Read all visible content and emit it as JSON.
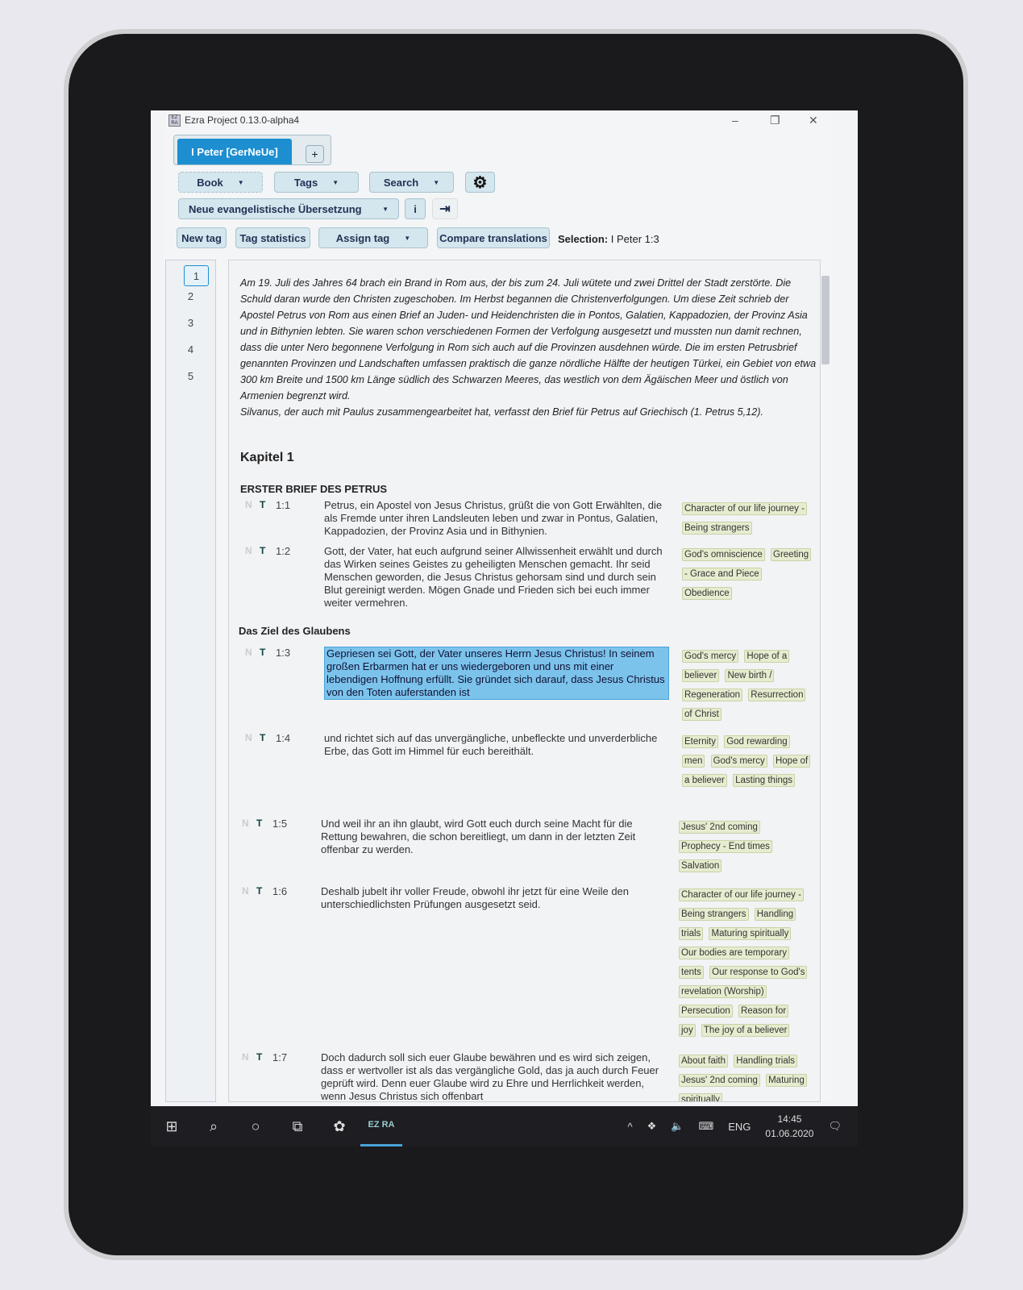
{
  "window": {
    "title": "Ezra Project 0.13.0-alpha4",
    "app_icon": "EZ RA",
    "min": "–",
    "max": "❐",
    "close": "✕"
  },
  "tabs": {
    "active": "I Peter [GerNeUe]",
    "add": "+"
  },
  "toolbar": {
    "book": "Book",
    "tags": "Tags",
    "search": "Search",
    "settings_icon": "gear-icon",
    "translation": "Neue evangelistische Übersetzung",
    "info": "i",
    "exit_icon": "exit-icon",
    "new_tag": "New tag",
    "tag_statistics": "Tag statistics",
    "assign_tag": "Assign tag",
    "compare": "Compare translations",
    "selection_label": "Selection:",
    "selection_value": "I Peter 1:3"
  },
  "chapters": [
    "1",
    "2",
    "3",
    "4",
    "5"
  ],
  "active_chapter": "1",
  "intro": "Am 19. Juli des Jahres 64 brach ein Brand in Rom aus, der bis zum 24. Juli wütete und zwei Drittel der Stadt zerstörte. Die Schuld daran wurde den Christen zugeschoben. Im Herbst begannen die Christenverfolgungen. Um diese Zeit schrieb der Apostel Petrus von Rom aus einen Brief an Juden- und Heidenchristen die in Pontos, Galatien, Kappadozien, der Provinz Asia und in Bithynien lebten. Sie waren schon verschiedenen Formen der Verfolgung ausgesetzt und mussten nun damit rechnen, dass die unter Nero begonnene Verfolgung in Rom sich auch auf die Provinzen ausdehnen würde. Die im ersten Petrusbrief genannten Provinzen und Landschaften umfassen praktisch die ganze nördliche Hälfte der heutigen Türkei, ein Gebiet von etwa 300 km Breite und 1500 km Länge südlich des Schwarzen Meeres, das westlich von dem Ägäischen Meer und östlich von Armenien begrenzt wird.",
  "intro2": "Silvanus, der auch mit Paulus zusammengearbeitet hat, verfasst den Brief für Petrus auf Griechisch (1. Petrus 5,12).",
  "chapter_heading": "Kapitel 1",
  "section1": "ERSTER BRIEF DES PETRUS",
  "section2": "Das Ziel des Glaubens",
  "verses": [
    {
      "n": "N",
      "t": "T",
      "ref": "1:1",
      "text": "Petrus, ein Apostel von Jesus Christus, grüßt die von Gott Erwählten, die als Fremde unter ihren Landsleuten leben und zwar in Pontus, Galatien, Kappadozien, der Provinz Asia und in Bithynien.",
      "tags": [
        "Character of our life journey - Being strangers"
      ]
    },
    {
      "n": "N",
      "t": "T",
      "ref": "1:2",
      "text": "Gott, der Vater, hat euch aufgrund seiner Allwissenheit erwählt und durch das Wirken seines Geistes zu geheiligten Menschen gemacht. Ihr seid Menschen geworden, die Jesus Christus gehorsam sind und durch sein Blut gereinigt werden. Mögen Gnade und Frieden sich bei euch immer weiter vermehren.",
      "tags": [
        "God's omniscience",
        "Greeting - Grace and Piece",
        "Obedience"
      ]
    },
    {
      "n": "N",
      "t": "T",
      "ref": "1:3",
      "text": "Gepriesen sei Gott, der Vater unseres Herrn Jesus Christus! In seinem großen Erbarmen hat er uns wiedergeboren und uns mit einer lebendigen Hoffnung erfüllt. Sie gründet sich darauf, dass Jesus Christus von den Toten auferstanden ist",
      "tags": [
        "God's mercy",
        "Hope of a believer",
        "New birth / Regeneration",
        "Resurrection of Christ"
      ]
    },
    {
      "n": "N",
      "t": "T",
      "ref": "1:4",
      "text": "und richtet sich auf das unvergängliche, unbefleckte und unverderbliche Erbe, das Gott im Himmel für euch bereithält.",
      "tags": [
        "Eternity",
        "God rewarding men",
        "God's mercy",
        "Hope of a believer",
        "Lasting things"
      ]
    },
    {
      "n": "N",
      "t": "T",
      "ref": "1:5",
      "text": "Und weil ihr an ihn glaubt, wird Gott euch durch seine Macht für die Rettung bewahren, die schon bereitliegt, um dann in der letzten Zeit offenbar zu werden.",
      "tags": [
        "Jesus' 2nd coming",
        "Prophecy - End times",
        "Salvation"
      ]
    },
    {
      "n": "N",
      "t": "T",
      "ref": "1:6",
      "text": "Deshalb jubelt ihr voller Freude, obwohl ihr jetzt für eine Weile den unterschiedlichsten Prüfungen ausgesetzt seid.",
      "tags": [
        "Character of our life journey - Being strangers",
        "Handling trials",
        "Maturing spiritually",
        "Our bodies are temporary tents",
        "Our response to God's revelation (Worship)",
        "Persecution",
        "Reason for joy",
        "The joy of a believer"
      ]
    },
    {
      "n": "N",
      "t": "T",
      "ref": "1:7",
      "text": "Doch dadurch soll sich euer Glaube bewähren und es wird sich zeigen, dass er wertvoller ist als das vergängliche Gold, das ja auch durch Feuer geprüft wird. Denn euer Glaube wird zu Ehre und Herrlichkeit werden, wenn Jesus Christus sich offenbart",
      "tags": [
        "About faith",
        "Handling trials",
        "Jesus' 2nd coming",
        "Maturing spiritually"
      ]
    }
  ],
  "selected_verse": "1:3",
  "taskbar": {
    "time": "14:45",
    "date": "01.06.2020",
    "lang": "ENG",
    "app": "EZ RA"
  },
  "colors": {
    "accent": "#1d8ed0",
    "highlight": "#7cc3ec",
    "tag_bg": "#e6eccf"
  }
}
